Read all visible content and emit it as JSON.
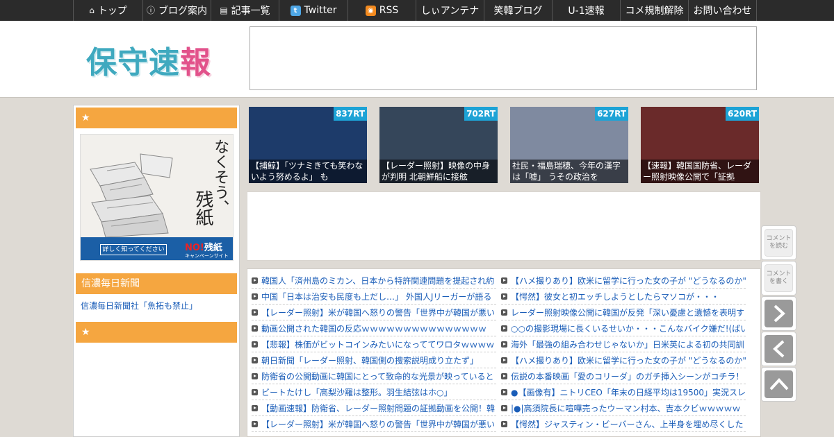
{
  "nav": [
    {
      "icon": "home-icon",
      "glyph": "⌂",
      "label": "トップ",
      "w": 100
    },
    {
      "icon": "info-icon",
      "glyph": "ⓘ",
      "label": "ブログ案内",
      "w": 98
    },
    {
      "icon": "list-icon",
      "glyph": "▤",
      "label": "記事一覧",
      "w": 98
    },
    {
      "icon": "twitter-icon",
      "glyph": "t",
      "label": "Twitter",
      "w": 99
    },
    {
      "icon": "rss-icon",
      "glyph": "◉",
      "label": "RSS",
      "w": 98
    },
    {
      "icon": "",
      "glyph": "",
      "label": "しぃアンテナ",
      "w": 98
    },
    {
      "icon": "",
      "glyph": "",
      "label": "笑韓ブログ",
      "w": 98
    },
    {
      "icon": "",
      "glyph": "",
      "label": "U-1速報",
      "w": 98
    },
    {
      "icon": "",
      "glyph": "",
      "label": "コメ規制解除",
      "w": 98
    },
    {
      "icon": "",
      "glyph": "",
      "label": "お問い合わせ",
      "w": 99
    }
  ],
  "logo": {
    "text_a": "保守速",
    "text_b": "報"
  },
  "sidebar": {
    "head1": "★",
    "banner": {
      "line1": "なくそう、",
      "line2": "残紙",
      "button": "詳しく知ってください",
      "badge_no": "NO!",
      "badge_text": "残紙",
      "badge_sub": "キャンペーンサイト"
    },
    "head2": "信濃毎日新聞",
    "link": "信濃毎日新聞社「魚拓も禁止」",
    "head3": "★"
  },
  "thumbs": [
    {
      "rt": "837RT",
      "caption": "【捕鯨】「ツナミきても笑わないよう努めるよ」 も",
      "color": "#1d3b6a"
    },
    {
      "rt": "702RT",
      "caption": "【レーダー照射】映像の中身が判明 北朝鮮船に接舷",
      "color": "#35465a"
    },
    {
      "rt": "627RT",
      "caption": "社民・福島瑞穂、今年の漢字は「嘘」 うその政治を",
      "color": "#7f8aa0"
    },
    {
      "rt": "620RT",
      "caption": "【速報】韓国国防省、レーダー照射映像公開で「証拠",
      "color": "#6a2a2a"
    }
  ],
  "feed_left": [
    "韓国人「済州島のミカン、日本から特許関連問題を提起され約",
    "中国「日本は治安も民度も上だし…」 外国人Jリーガーが語る",
    "【レーダー照射】米が韓国へ怒りの警告「世界中が韓国が悪い",
    "動画公開された韓国の反応ｗｗｗｗｗｗｗｗｗｗｗｗｗｗｗ",
    "【悲報】株価がビットコインみたいになっててワロタｗｗｗｗ",
    "朝日新聞「レーダー照射、韓国側の捜索説明成り立たず」",
    "防衛省の公開動画に韓国にとって致命的な光景が映っていると",
    "ビートたけし「高梨沙羅は整形。羽生結弦はホ○」",
    "【動画速報】防衛省、レーダー照射問題の証拠動画を公開！韓",
    "【レーダー照射】米が韓国へ怒りの警告「世界中が韓国が悪い"
  ],
  "feed_right": [
    "【ハメ撮りあり】欧米に留学に行った女の子が \"どうなるのか\"",
    "【愕然】彼女と初エッチしようとしたらマソコが・・・",
    "レーダー照射映像公開に韓国が反発「深い憂慮と遺憾を表明す",
    "○○の撮影現場に長くいるせいか・・・こんなバイク嫌だ!(ばい",
    "海外「最強の組み合わせじゃないか」日米英による初の共同訓",
    "【ハメ撮りあり】欧米に留学に行った女の子が \"どうなるのか\"",
    "伝説の本番映画「愛のコリーダ」のガチ挿入シーンがコチラ！",
    "●【画像有】ニトリCEO「年末の日経平均は19500」実況スレ「",
    "|●|高須院長に喧嘩売ったウーマン村本、吉本クビｗｗｗｗｗ",
    "【愕然】ジャスティン・ビーバーさん、上半身を埋め尽くした"
  ],
  "floating": {
    "read": "コメント を読む",
    "write": "コメント を書く"
  },
  "colors": {
    "accent": "#f5a640",
    "link": "#1a5db8",
    "badge": "#1da3d6"
  }
}
